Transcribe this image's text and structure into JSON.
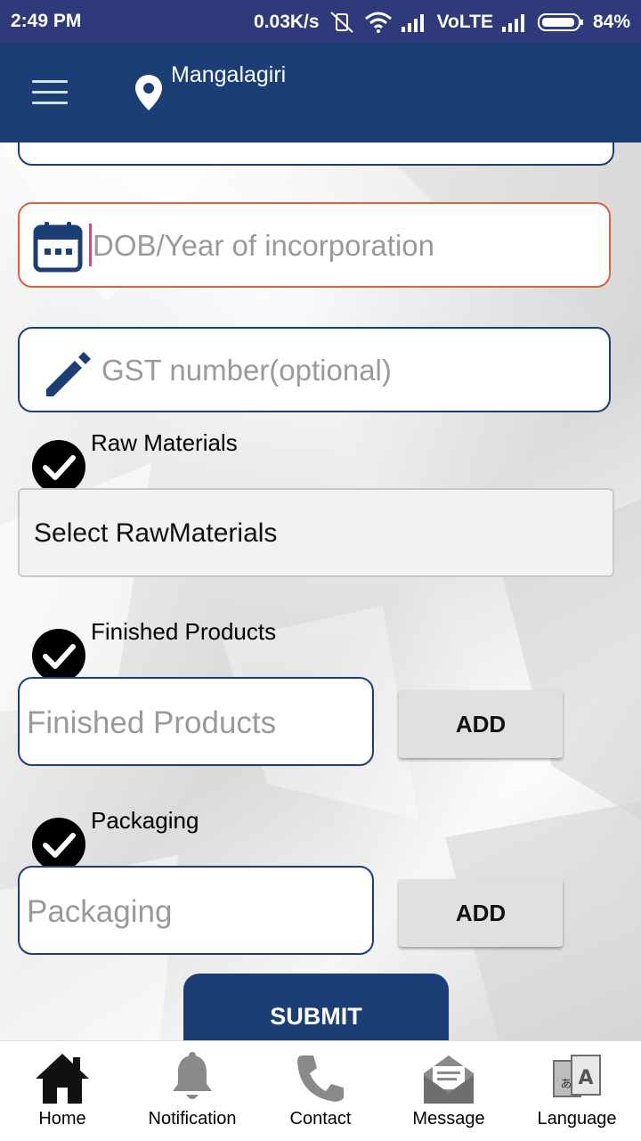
{
  "status_bar": {
    "time": "2:49 PM",
    "speed": "0.03K/s",
    "network": "VoLTE",
    "battery": "84%"
  },
  "app_bar": {
    "location": "Mangalagiri"
  },
  "form": {
    "dob_placeholder": "DOB/Year of incorporation",
    "gst_placeholder": "GST number(optional)",
    "raw_materials_label": "Raw Materials",
    "raw_materials_select": "Select RawMaterials",
    "finished_products_label": "Finished Products",
    "finished_products_placeholder": "Finished Products",
    "packaging_label": "Packaging",
    "packaging_placeholder": "Packaging",
    "add_label": "ADD",
    "submit_label": "SUBMIT"
  },
  "bottom_nav": {
    "items": [
      {
        "label": "Home",
        "icon": "home-icon"
      },
      {
        "label": "Notification",
        "icon": "bell-icon"
      },
      {
        "label": "Contact",
        "icon": "phone-icon"
      },
      {
        "label": "Message",
        "icon": "mail-icon"
      },
      {
        "label": "Language",
        "icon": "translate-icon"
      }
    ]
  },
  "colors": {
    "primary": "#1b3f74",
    "status_bar": "#2e3a7a",
    "focus_border": "#e0603a",
    "cursor": "#e0447a"
  }
}
